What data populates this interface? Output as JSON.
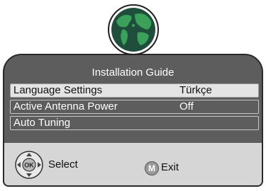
{
  "dialog": {
    "title": "Installation Guide",
    "items": [
      {
        "label": "Language Settings",
        "value": "Türkçe",
        "selected": true
      },
      {
        "label": "Active Antenna Power",
        "value": "Off",
        "selected": false
      },
      {
        "label": "Auto Tuning",
        "value": "",
        "selected": false
      }
    ]
  },
  "footer": {
    "ok_key": "OK",
    "select_label": "Select",
    "m_key": "M",
    "exit_label": "Exit"
  },
  "icons": {
    "header": "globe-icon",
    "navigation": "dpad-ok-icon",
    "menu_key": "m-key-icon"
  },
  "colors": {
    "panel_bg": "#5d5d5d",
    "selected_row_bg": "#e4e4e4",
    "footer_bg": "#d6d6d6",
    "globe_ocean": "#1f4e3d",
    "globe_land": "#3aa05a"
  }
}
